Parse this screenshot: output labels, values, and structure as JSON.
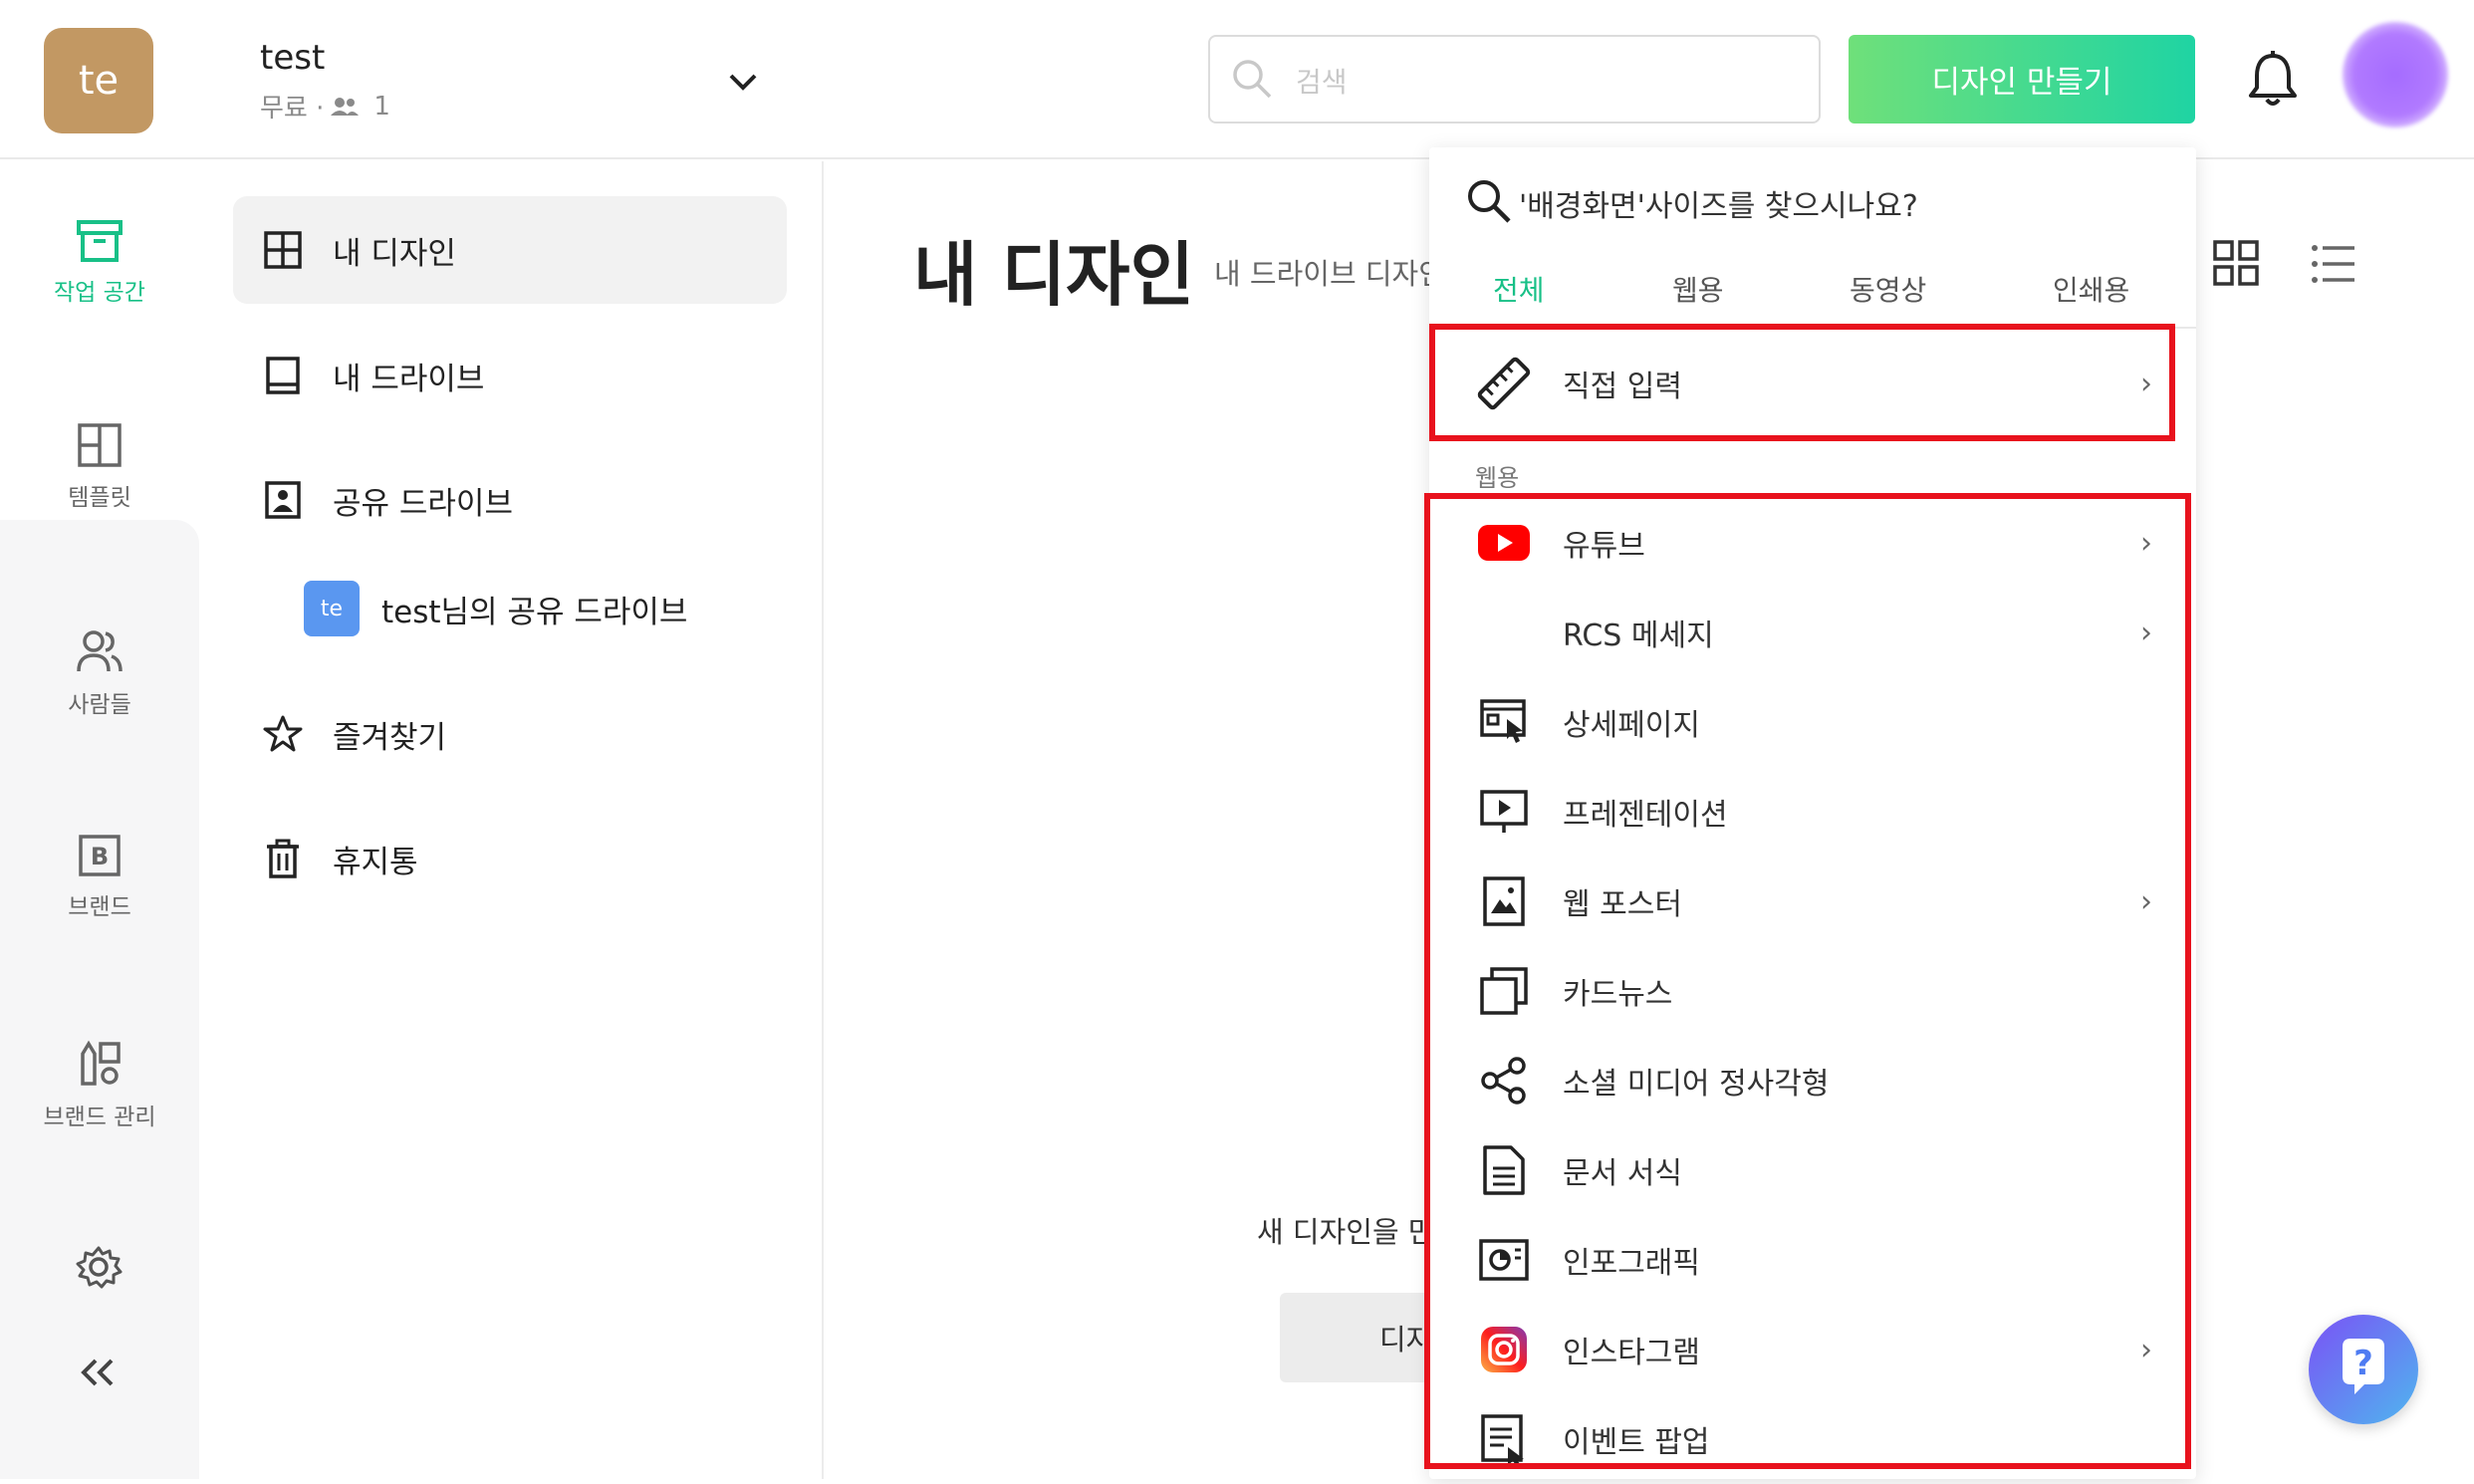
{
  "header": {
    "team_avatar": "te",
    "team_name": "test",
    "team_plan": "무료 ·",
    "team_members": "1",
    "search_placeholder": "검색",
    "create_button": "디자인 만들기"
  },
  "rail": {
    "items": [
      {
        "label": "작업 공간",
        "icon": "archive-icon"
      },
      {
        "label": "템플릿",
        "icon": "layout-icon"
      },
      {
        "label": "사람들",
        "icon": "people-icon"
      },
      {
        "label": "브랜드",
        "icon": "brand-b-icon"
      },
      {
        "label": "브랜드 관리",
        "icon": "brand-manage-icon"
      }
    ],
    "accent": "#18c087"
  },
  "sidebar": {
    "items": [
      {
        "label": "내 디자인"
      },
      {
        "label": "내 드라이브"
      },
      {
        "label": "공유 드라이브"
      },
      {
        "label": "즐겨찾기"
      },
      {
        "label": "휴지통"
      }
    ],
    "shared_sub": {
      "avatar": "te",
      "label": "test님의 공유 드라이브"
    }
  },
  "main": {
    "title": "내 디자인",
    "subtitle": "내 드라이브 디자인",
    "empty_text": "새 디자인을 만",
    "empty_button": "디자"
  },
  "dropdown": {
    "search_hint": "'배경화면'사이즈를 찾으시나요?",
    "tabs": [
      "전체",
      "웹용",
      "동영상",
      "인쇄용"
    ],
    "custom_row": "직접 입력",
    "section_label": "웹용",
    "rows": [
      {
        "label": "유튜브",
        "chevron": "›"
      },
      {
        "label": "RCS 메세지",
        "chevron": "›"
      },
      {
        "label": "상세페이지",
        "chevron": ""
      },
      {
        "label": "프레젠테이션",
        "chevron": ""
      },
      {
        "label": "웹 포스터",
        "chevron": "›"
      },
      {
        "label": "카드뉴스",
        "chevron": ""
      },
      {
        "label": "소셜 미디어 정사각형",
        "chevron": ""
      },
      {
        "label": "문서 서식",
        "chevron": ""
      },
      {
        "label": "인포그래픽",
        "chevron": ""
      },
      {
        "label": "인스타그램",
        "chevron": "›"
      },
      {
        "label": "이벤트 팝업",
        "chevron": ""
      }
    ],
    "chevron_glyph": "›"
  },
  "help": {
    "label": "?"
  }
}
